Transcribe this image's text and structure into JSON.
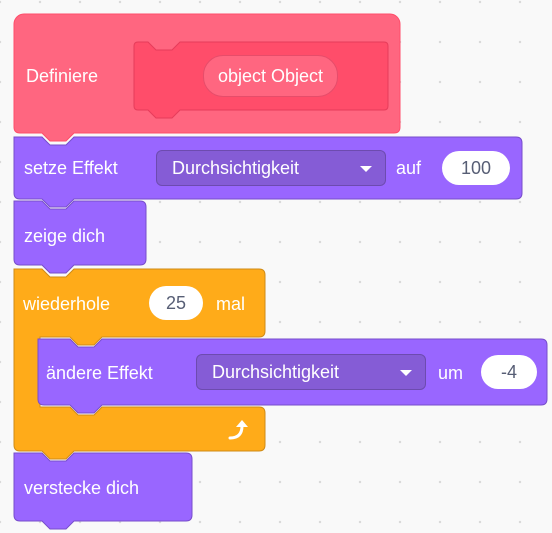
{
  "define_block": {
    "label": "Definiere",
    "argument": "object Object"
  },
  "set_effect_block": {
    "label": "setze Effekt",
    "effect": "Durchsichtigkeit",
    "to_label": "auf",
    "value": "100"
  },
  "show_block": {
    "label": "zeige dich"
  },
  "repeat_block": {
    "label": "wiederhole",
    "count": "25",
    "times_label": "mal"
  },
  "change_effect_block": {
    "label": "ändere Effekt",
    "effect": "Durchsichtigkeit",
    "by_label": "um",
    "value": "-4"
  },
  "hide_block": {
    "label": "verstecke dich"
  },
  "colors": {
    "define": "#ff6680",
    "define_border": "#ff4d6a",
    "define_inner": "#ff4d6a",
    "looks": "#9966ff",
    "looks_border": "#774dcb",
    "looks_dropdown": "#855cd6",
    "control": "#ffab19",
    "control_border": "#cf8b17"
  },
  "icons": {
    "loop_arrow": "loop-arrow-icon",
    "dropdown_caret": "caret-down-icon"
  }
}
